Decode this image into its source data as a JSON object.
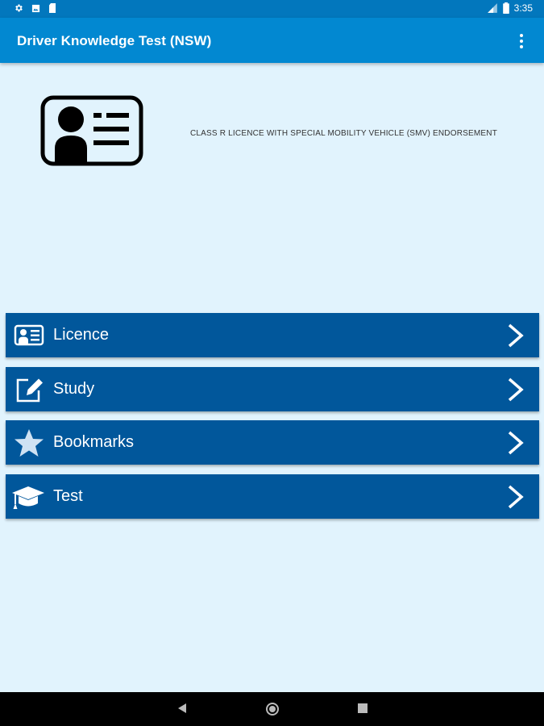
{
  "status_bar": {
    "time": "3:35",
    "icons": [
      "settings-icon",
      "image-icon",
      "sd-card-icon",
      "signal-icon",
      "battery-icon"
    ]
  },
  "app_bar": {
    "title": "Driver Knowledge Test (NSW)",
    "menu_icon": "more-vert-icon"
  },
  "hero": {
    "icon": "id-card-icon",
    "subtitle": "CLASS R LICENCE WITH SPECIAL MOBILITY VEHICLE (SMV) ENDORSEMENT"
  },
  "menu": {
    "items": [
      {
        "label": "Licence",
        "icon": "id-card-icon"
      },
      {
        "label": "Study",
        "icon": "edit-icon"
      },
      {
        "label": "Bookmarks",
        "icon": "star-icon"
      },
      {
        "label": "Test",
        "icon": "graduation-cap-icon"
      }
    ]
  },
  "colors": {
    "status_bar": "#0277bd",
    "app_bar": "#0288d1",
    "background": "#e1f3fd",
    "menu_item": "#01579b"
  }
}
